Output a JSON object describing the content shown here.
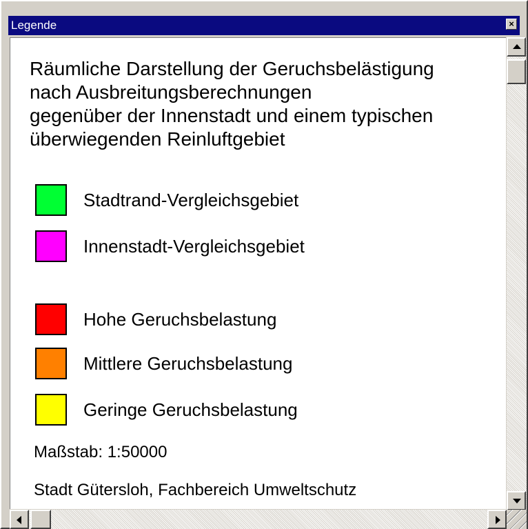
{
  "window": {
    "title": "Legende",
    "close_symbol": "×"
  },
  "legend": {
    "heading": "Räumliche Darstellung der Geruchsbelästigung\nnach Ausbreitungsberechnungen\ngegenüber der Innenstadt und einem typischen\nüberwiegenden Reinluftgebiet",
    "items": [
      {
        "label": "Stadtrand-Vergleichsgebiet",
        "color": "#00ff33"
      },
      {
        "label": "Innenstadt-Vergleichsgebiet",
        "color": "#ff00ff"
      },
      {
        "label": "Hohe Geruchsbelastung",
        "color": "#ff0000"
      },
      {
        "label": "Mittlere Geruchsbelastung",
        "color": "#ff8000"
      },
      {
        "label": "Geringe Geruchsbelastung",
        "color": "#ffff00"
      }
    ],
    "scale": "Maßstab: 1:50000",
    "source": "Stadt Gütersloh, Fachbereich Umweltschutz"
  },
  "icons": {
    "close": "close-icon",
    "scroll_up": "arrow-up-icon",
    "scroll_down": "arrow-down-icon",
    "scroll_left": "arrow-left-icon",
    "scroll_right": "arrow-right-icon",
    "resize_grip": "resize-grip-icon"
  }
}
